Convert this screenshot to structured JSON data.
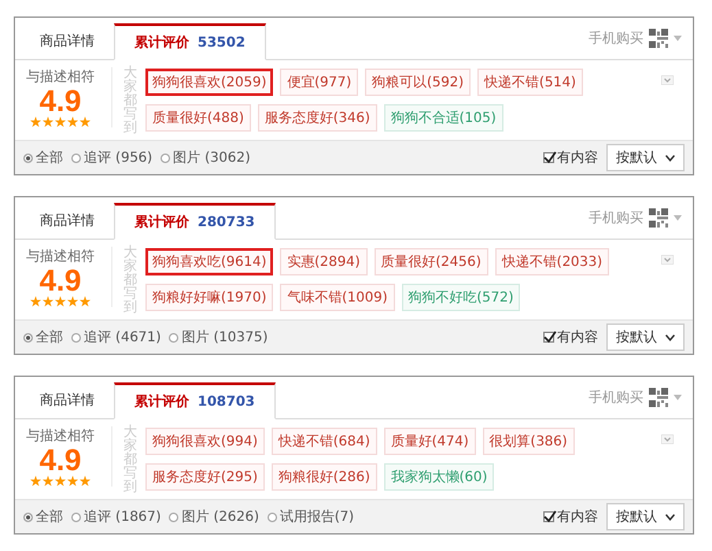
{
  "panels": [
    {
      "tabs": [
        {
          "label": "商品详情",
          "selected": false
        },
        {
          "label": "累计评价",
          "count": "53502",
          "selected": true
        }
      ],
      "mobile_buy": "手机购买",
      "rating": {
        "label": "与描述相符",
        "score": "4.9",
        "stars": 5
      },
      "tags_label": "大家都写到",
      "tags": [
        {
          "text": "狗狗很喜欢(2059)",
          "kind": "positive",
          "highlighted": true
        },
        {
          "text": "便宜(977)",
          "kind": "positive",
          "highlighted": false
        },
        {
          "text": "狗粮可以(592)",
          "kind": "positive",
          "highlighted": false
        },
        {
          "text": "快递不错(514)",
          "kind": "positive",
          "highlighted": false
        },
        {
          "text": "质量很好(488)",
          "kind": "positive",
          "highlighted": false
        },
        {
          "text": "服务态度好(346)",
          "kind": "positive",
          "highlighted": false
        },
        {
          "text": "狗狗不合适(105)",
          "kind": "negative",
          "highlighted": false
        }
      ],
      "filters": [
        {
          "label": "全部",
          "selected": true
        },
        {
          "label": "追评 (956)",
          "selected": false
        },
        {
          "label": "图片 (3062)",
          "selected": false
        }
      ],
      "has_content": {
        "label": "有内容",
        "checked": true
      },
      "sort": "按默认"
    },
    {
      "tabs": [
        {
          "label": "商品详情",
          "selected": false
        },
        {
          "label": "累计评价",
          "count": "280733",
          "selected": true
        }
      ],
      "mobile_buy": "手机购买",
      "rating": {
        "label": "与描述相符",
        "score": "4.9",
        "stars": 5
      },
      "tags_label": "大家都写到",
      "tags": [
        {
          "text": "狗狗喜欢吃(9614)",
          "kind": "positive",
          "highlighted": true
        },
        {
          "text": "实惠(2894)",
          "kind": "positive",
          "highlighted": false
        },
        {
          "text": "质量很好(2456)",
          "kind": "positive",
          "highlighted": false
        },
        {
          "text": "快递不错(2033)",
          "kind": "positive",
          "highlighted": false
        },
        {
          "text": "狗粮好好嘛(1970)",
          "kind": "positive",
          "highlighted": false
        },
        {
          "text": "气味不错(1009)",
          "kind": "positive",
          "highlighted": false
        },
        {
          "text": "狗狗不好吃(572)",
          "kind": "negative",
          "highlighted": false
        }
      ],
      "filters": [
        {
          "label": "全部",
          "selected": true
        },
        {
          "label": "追评 (4671)",
          "selected": false
        },
        {
          "label": "图片 (10375)",
          "selected": false
        }
      ],
      "has_content": {
        "label": "有内容",
        "checked": true
      },
      "sort": "按默认"
    },
    {
      "tabs": [
        {
          "label": "商品详情",
          "selected": false
        },
        {
          "label": "累计评价",
          "count": "108703",
          "selected": true
        }
      ],
      "mobile_buy": "手机购买",
      "rating": {
        "label": "与描述相符",
        "score": "4.9",
        "stars": 5
      },
      "tags_label": "大家都写到",
      "tags": [
        {
          "text": "狗狗很喜欢(994)",
          "kind": "positive",
          "highlighted": false
        },
        {
          "text": "快递不错(684)",
          "kind": "positive",
          "highlighted": false
        },
        {
          "text": "质量好(474)",
          "kind": "positive",
          "highlighted": false
        },
        {
          "text": "很划算(386)",
          "kind": "positive",
          "highlighted": false
        },
        {
          "text": "服务态度好(295)",
          "kind": "positive",
          "highlighted": false
        },
        {
          "text": "狗粮很好(286)",
          "kind": "positive",
          "highlighted": false
        },
        {
          "text": "我家狗太懒(60)",
          "kind": "negative",
          "highlighted": false
        }
      ],
      "filters": [
        {
          "label": "全部",
          "selected": true
        },
        {
          "label": "追评 (1867)",
          "selected": false
        },
        {
          "label": "图片 (2626)",
          "selected": false
        },
        {
          "label": "试用报告(7)",
          "selected": false
        }
      ],
      "has_content": {
        "label": "有内容",
        "checked": true
      },
      "sort": "按默认"
    }
  ]
}
